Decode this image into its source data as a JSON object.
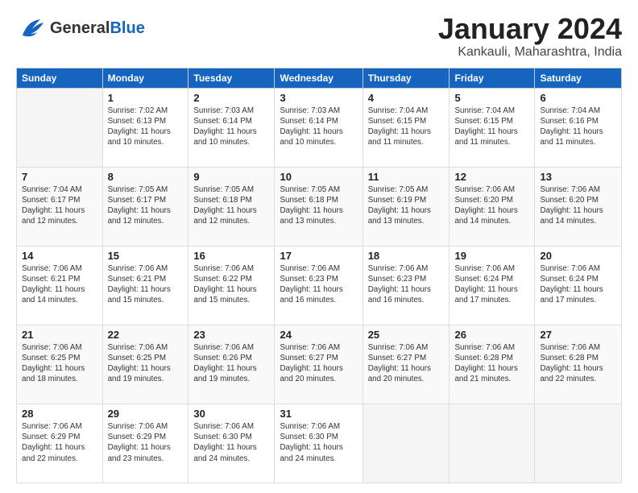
{
  "header": {
    "logo_general": "General",
    "logo_blue": "Blue",
    "title": "January 2024",
    "subtitle": "Kankauli, Maharashtra, India"
  },
  "calendar": {
    "days_of_week": [
      "Sunday",
      "Monday",
      "Tuesday",
      "Wednesday",
      "Thursday",
      "Friday",
      "Saturday"
    ],
    "weeks": [
      [
        {
          "day": "",
          "info": ""
        },
        {
          "day": "1",
          "info": "Sunrise: 7:02 AM\nSunset: 6:13 PM\nDaylight: 11 hours\nand 10 minutes."
        },
        {
          "day": "2",
          "info": "Sunrise: 7:03 AM\nSunset: 6:14 PM\nDaylight: 11 hours\nand 10 minutes."
        },
        {
          "day": "3",
          "info": "Sunrise: 7:03 AM\nSunset: 6:14 PM\nDaylight: 11 hours\nand 10 minutes."
        },
        {
          "day": "4",
          "info": "Sunrise: 7:04 AM\nSunset: 6:15 PM\nDaylight: 11 hours\nand 11 minutes."
        },
        {
          "day": "5",
          "info": "Sunrise: 7:04 AM\nSunset: 6:15 PM\nDaylight: 11 hours\nand 11 minutes."
        },
        {
          "day": "6",
          "info": "Sunrise: 7:04 AM\nSunset: 6:16 PM\nDaylight: 11 hours\nand 11 minutes."
        }
      ],
      [
        {
          "day": "7",
          "info": "Sunrise: 7:04 AM\nSunset: 6:17 PM\nDaylight: 11 hours\nand 12 minutes."
        },
        {
          "day": "8",
          "info": "Sunrise: 7:05 AM\nSunset: 6:17 PM\nDaylight: 11 hours\nand 12 minutes."
        },
        {
          "day": "9",
          "info": "Sunrise: 7:05 AM\nSunset: 6:18 PM\nDaylight: 11 hours\nand 12 minutes."
        },
        {
          "day": "10",
          "info": "Sunrise: 7:05 AM\nSunset: 6:18 PM\nDaylight: 11 hours\nand 13 minutes."
        },
        {
          "day": "11",
          "info": "Sunrise: 7:05 AM\nSunset: 6:19 PM\nDaylight: 11 hours\nand 13 minutes."
        },
        {
          "day": "12",
          "info": "Sunrise: 7:06 AM\nSunset: 6:20 PM\nDaylight: 11 hours\nand 14 minutes."
        },
        {
          "day": "13",
          "info": "Sunrise: 7:06 AM\nSunset: 6:20 PM\nDaylight: 11 hours\nand 14 minutes."
        }
      ],
      [
        {
          "day": "14",
          "info": "Sunrise: 7:06 AM\nSunset: 6:21 PM\nDaylight: 11 hours\nand 14 minutes."
        },
        {
          "day": "15",
          "info": "Sunrise: 7:06 AM\nSunset: 6:21 PM\nDaylight: 11 hours\nand 15 minutes."
        },
        {
          "day": "16",
          "info": "Sunrise: 7:06 AM\nSunset: 6:22 PM\nDaylight: 11 hours\nand 15 minutes."
        },
        {
          "day": "17",
          "info": "Sunrise: 7:06 AM\nSunset: 6:23 PM\nDaylight: 11 hours\nand 16 minutes."
        },
        {
          "day": "18",
          "info": "Sunrise: 7:06 AM\nSunset: 6:23 PM\nDaylight: 11 hours\nand 16 minutes."
        },
        {
          "day": "19",
          "info": "Sunrise: 7:06 AM\nSunset: 6:24 PM\nDaylight: 11 hours\nand 17 minutes."
        },
        {
          "day": "20",
          "info": "Sunrise: 7:06 AM\nSunset: 6:24 PM\nDaylight: 11 hours\nand 17 minutes."
        }
      ],
      [
        {
          "day": "21",
          "info": "Sunrise: 7:06 AM\nSunset: 6:25 PM\nDaylight: 11 hours\nand 18 minutes."
        },
        {
          "day": "22",
          "info": "Sunrise: 7:06 AM\nSunset: 6:25 PM\nDaylight: 11 hours\nand 19 minutes."
        },
        {
          "day": "23",
          "info": "Sunrise: 7:06 AM\nSunset: 6:26 PM\nDaylight: 11 hours\nand 19 minutes."
        },
        {
          "day": "24",
          "info": "Sunrise: 7:06 AM\nSunset: 6:27 PM\nDaylight: 11 hours\nand 20 minutes."
        },
        {
          "day": "25",
          "info": "Sunrise: 7:06 AM\nSunset: 6:27 PM\nDaylight: 11 hours\nand 20 minutes."
        },
        {
          "day": "26",
          "info": "Sunrise: 7:06 AM\nSunset: 6:28 PM\nDaylight: 11 hours\nand 21 minutes."
        },
        {
          "day": "27",
          "info": "Sunrise: 7:06 AM\nSunset: 6:28 PM\nDaylight: 11 hours\nand 22 minutes."
        }
      ],
      [
        {
          "day": "28",
          "info": "Sunrise: 7:06 AM\nSunset: 6:29 PM\nDaylight: 11 hours\nand 22 minutes."
        },
        {
          "day": "29",
          "info": "Sunrise: 7:06 AM\nSunset: 6:29 PM\nDaylight: 11 hours\nand 23 minutes."
        },
        {
          "day": "30",
          "info": "Sunrise: 7:06 AM\nSunset: 6:30 PM\nDaylight: 11 hours\nand 24 minutes."
        },
        {
          "day": "31",
          "info": "Sunrise: 7:06 AM\nSunset: 6:30 PM\nDaylight: 11 hours\nand 24 minutes."
        },
        {
          "day": "",
          "info": ""
        },
        {
          "day": "",
          "info": ""
        },
        {
          "day": "",
          "info": ""
        }
      ]
    ]
  }
}
